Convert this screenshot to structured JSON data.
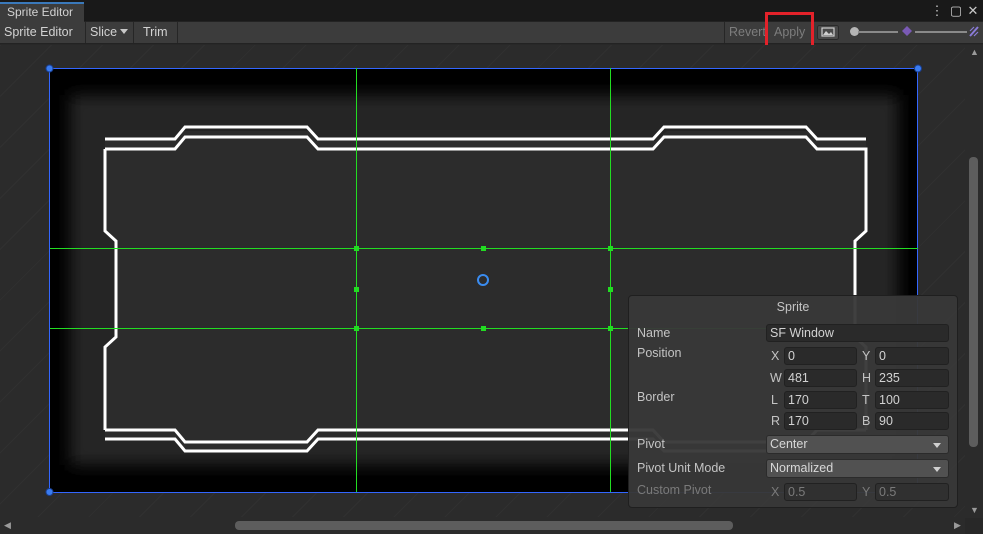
{
  "window": {
    "tab_title": "Sprite Editor",
    "kebab_glyph": "⋮",
    "maximize_glyph": "▢",
    "close_glyph": "✕"
  },
  "toolbar": {
    "sprite_editor_label": "Sprite Editor",
    "slice_label": "Slice",
    "trim_label": "Trim",
    "revert_label": "Revert",
    "apply_label": "Apply"
  },
  "inspector": {
    "title": "Sprite",
    "name_label": "Name",
    "name_value": "SF Window",
    "position_label": "Position",
    "x_label": "X",
    "x_value": "0",
    "y_label": "Y",
    "y_value": "0",
    "w_label": "W",
    "w_value": "481",
    "h_label": "H",
    "h_value": "235",
    "border_label": "Border",
    "l_label": "L",
    "l_value": "170",
    "t_label": "T",
    "t_value": "100",
    "r_label": "R",
    "r_value": "170",
    "b_label": "B",
    "b_value": "90",
    "pivot_label": "Pivot",
    "pivot_value": "Center",
    "pivot_unit_label": "Pivot Unit Mode",
    "pivot_unit_value": "Normalized",
    "custom_pivot_label": "Custom Pivot",
    "cp_x_label": "X",
    "cp_x_value": "0.5",
    "cp_y_label": "Y",
    "cp_y_value": "0.5"
  },
  "colors": {
    "accent": "#3a79bb",
    "highlight": "#e3222a",
    "slice_lines": "#22dd22",
    "rect_outline": "#3366ff"
  }
}
